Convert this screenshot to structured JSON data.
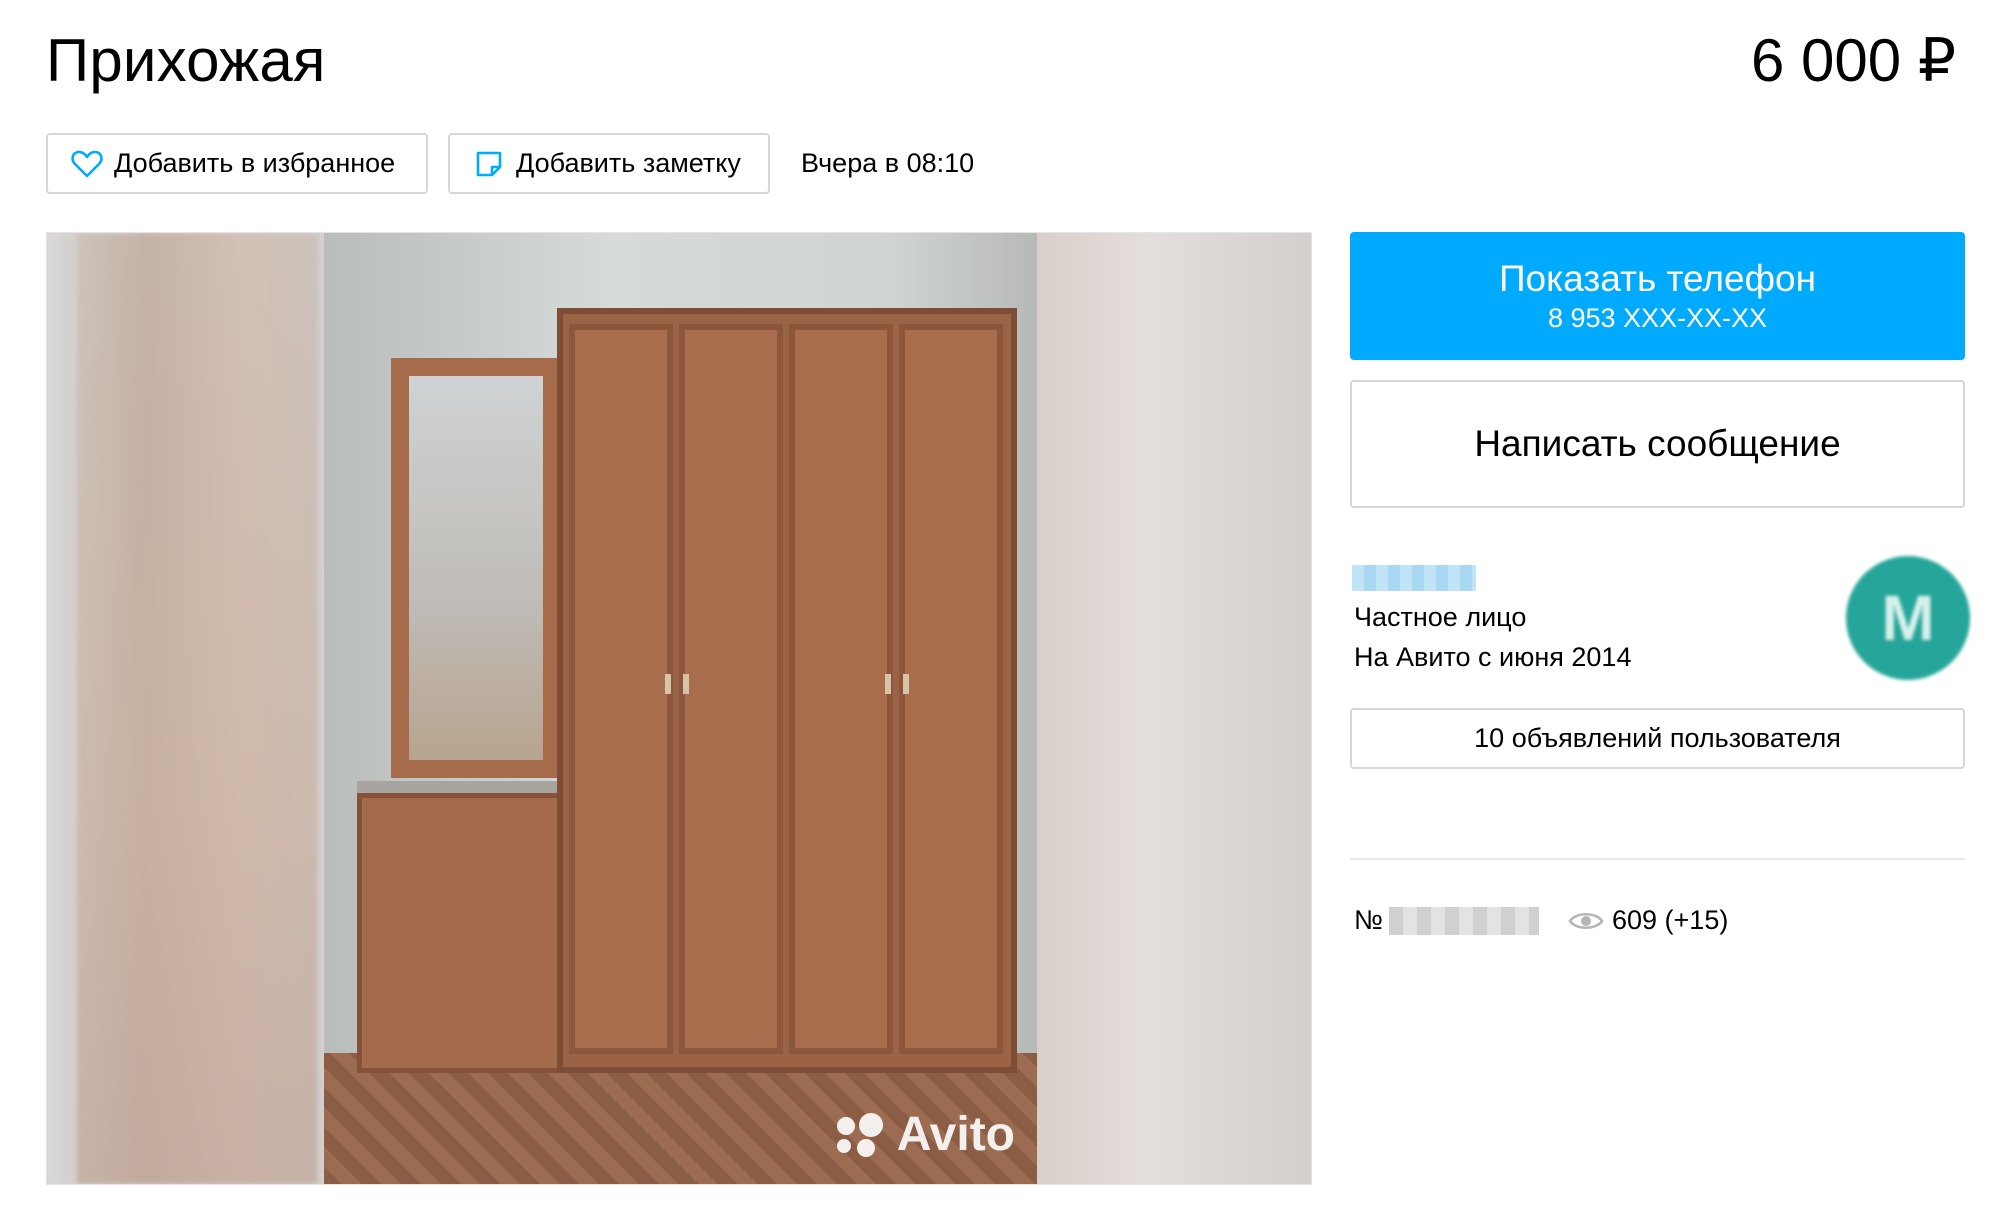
{
  "listing": {
    "title": "Прихожая",
    "price": "6 000 ₽",
    "posted": "Вчера в 08:10"
  },
  "actions": {
    "favorite_label": "Добавить в избранное",
    "note_label": "Добавить заметку"
  },
  "gallery": {
    "watermark": "Avito"
  },
  "contact": {
    "phone_label": "Показать телефон",
    "phone_masked": "8 953 XXX-XX-XX",
    "message_label": "Написать сообщение"
  },
  "seller": {
    "type": "Частное лицо",
    "since": "На Авито с июня 2014",
    "avatar_letter": "M",
    "ads_label": "10 объявлений пользователя"
  },
  "meta": {
    "number_prefix": "№",
    "views": "609 (+15)"
  },
  "colors": {
    "accent": "#00aaff",
    "avatar": "#26a69a",
    "border": "#d6d6d6"
  },
  "icons": [
    "heart-icon",
    "note-icon",
    "eye-icon"
  ]
}
